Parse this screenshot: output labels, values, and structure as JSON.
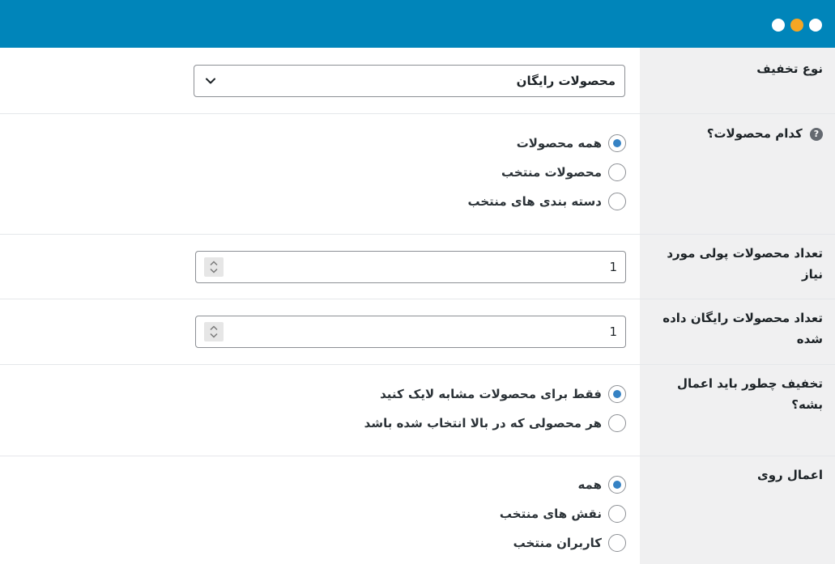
{
  "window": {
    "controls": [
      {
        "icon": "window-dot-white",
        "color": "#ffffff"
      },
      {
        "icon": "window-dot-orange",
        "color": "#f5a623"
      },
      {
        "icon": "window-dot-white",
        "color": "#ffffff"
      }
    ],
    "titlebar_color": "#0085ba"
  },
  "discount_type": {
    "label": "نوع تخفیف",
    "selected": "محصولات رایگان",
    "icon": "chevron-down-icon"
  },
  "which_products": {
    "label": "کدام محصولات؟",
    "help_icon": "?",
    "options": [
      {
        "label": "همه محصولات",
        "checked": true
      },
      {
        "label": "محصولات منتخب",
        "checked": false
      },
      {
        "label": "دسته بندی های منتخب",
        "checked": false
      }
    ]
  },
  "paid_required": {
    "label": "تعداد محصولات پولی مورد نیاز",
    "value": "1"
  },
  "free_given": {
    "label": "تعداد محصولات رایگان داده شده",
    "value": "1"
  },
  "apply_how": {
    "label": "تخفیف چطور باید اعمال بشه؟",
    "options": [
      {
        "label": "فقط برای محصولات مشابه لایک کنید",
        "checked": true
      },
      {
        "label": "هر محصولی که در بالا انتخاب شده باشد",
        "checked": false
      }
    ]
  },
  "apply_on": {
    "label": "اعمال روی",
    "options": [
      {
        "label": "همه",
        "checked": true
      },
      {
        "label": "نقش های منتخب",
        "checked": false
      },
      {
        "label": "کاربران منتخب",
        "checked": false
      }
    ]
  },
  "colors": {
    "accent": "#3582c4",
    "label_background": "#f0f0f1"
  }
}
